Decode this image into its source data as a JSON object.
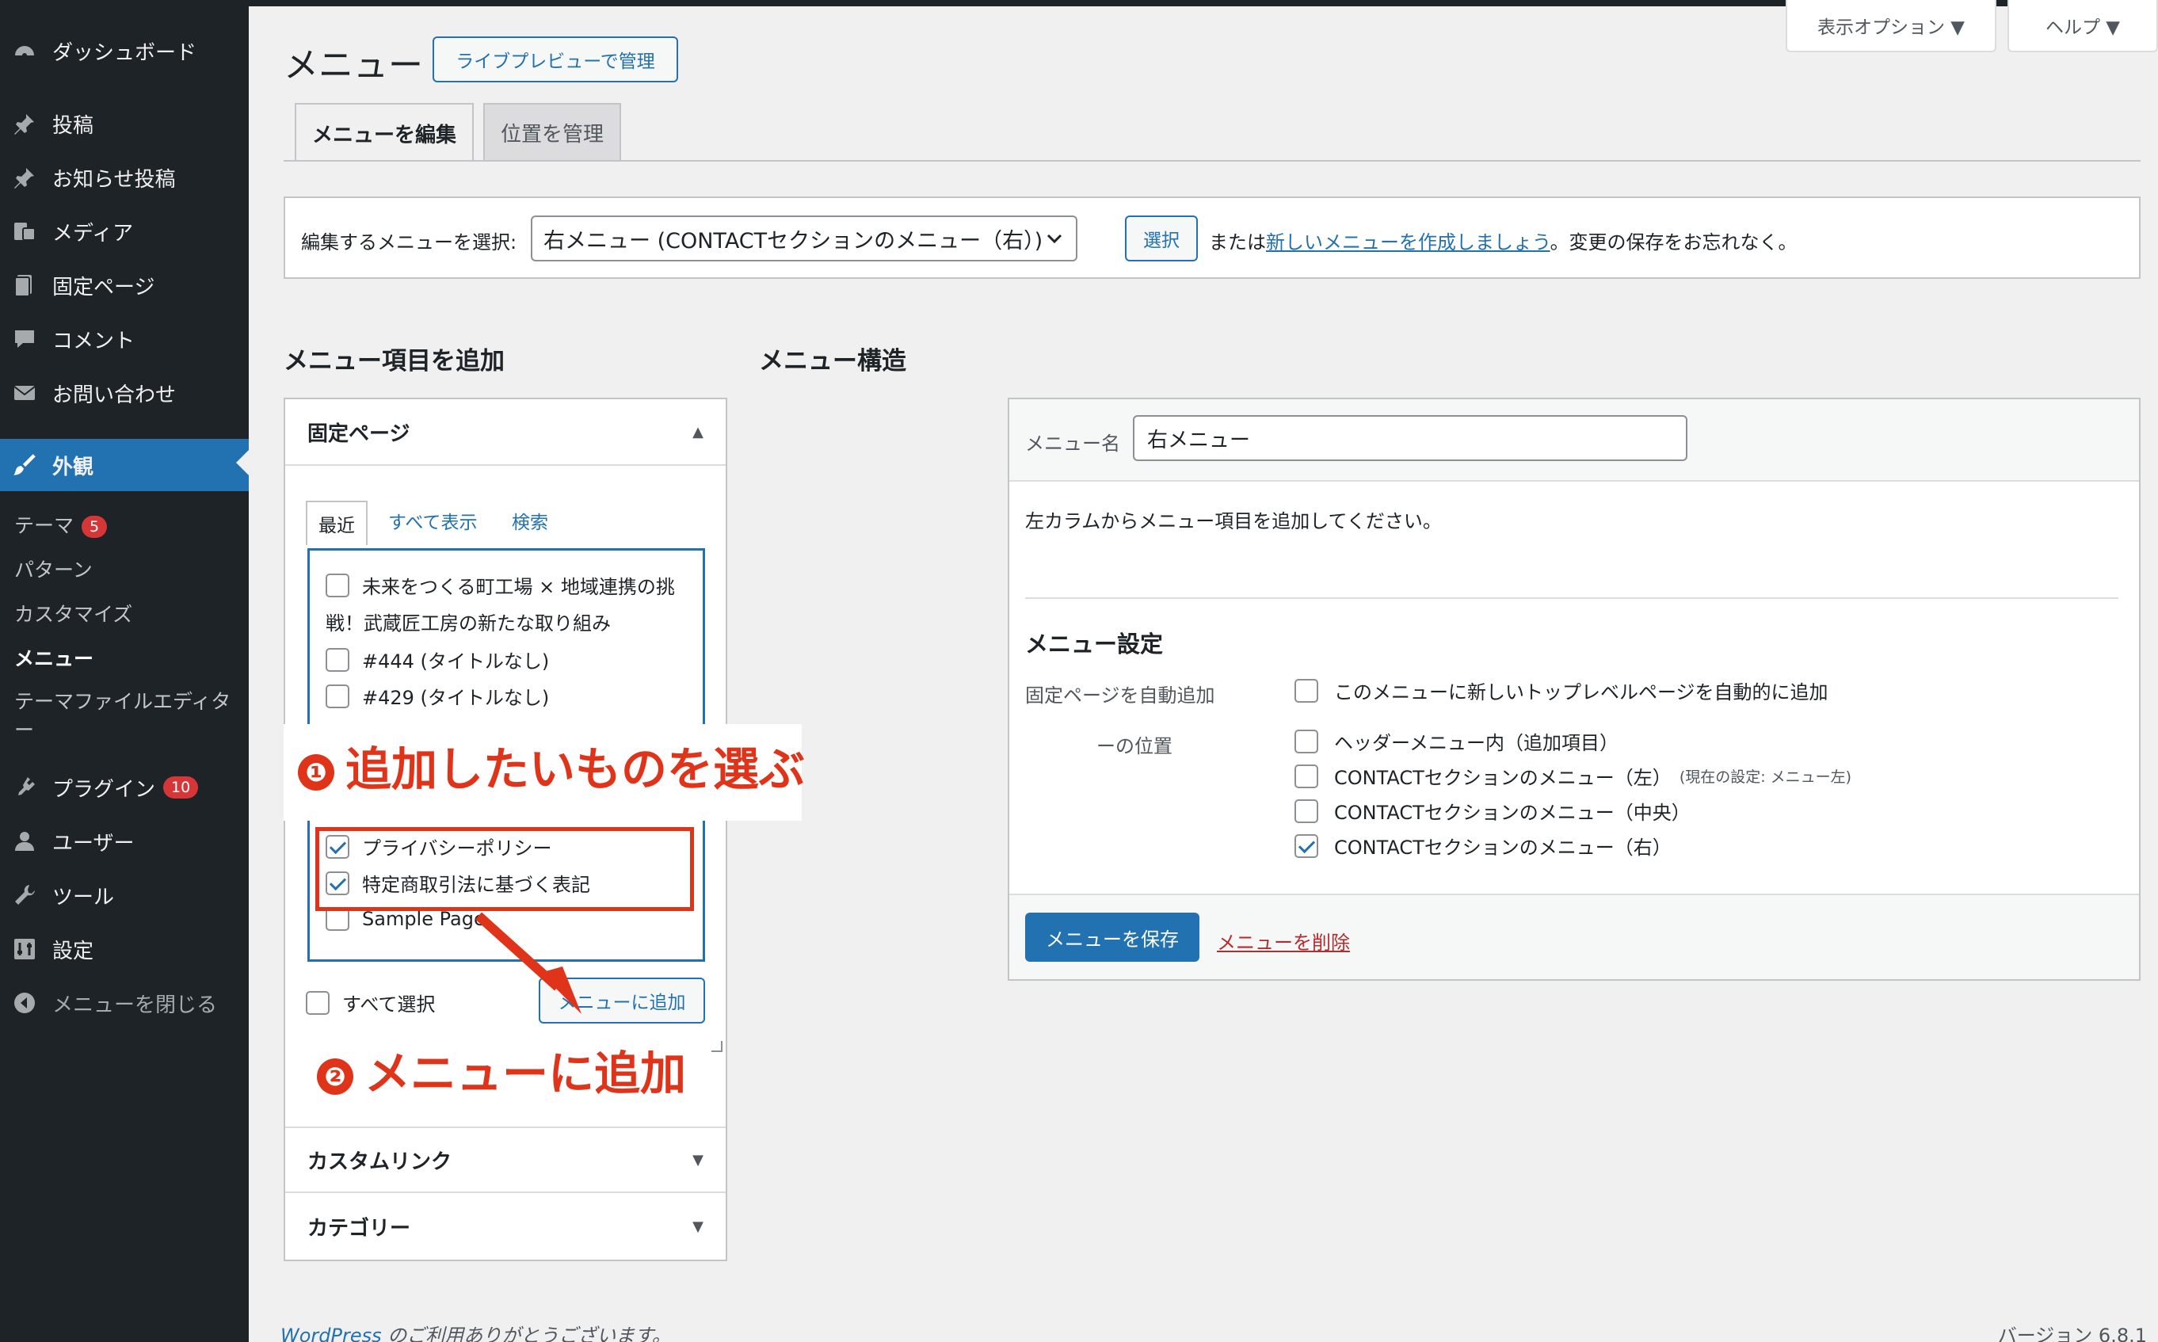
{
  "sidebar": {
    "dashboard": "ダッシュボード",
    "posts": "投稿",
    "news": "お知らせ投稿",
    "media": "メディア",
    "pages": "固定ページ",
    "comments": "コメント",
    "contact": "お問い合わせ",
    "appearance": "外観",
    "sub": {
      "themes": "テーマ",
      "themes_badge": "5",
      "patterns": "パターン",
      "customize": "カスタマイズ",
      "menus": "メニュー",
      "theme_editor_1": "テーマファイルエディタ",
      "theme_editor_2": "ー"
    },
    "plugins": "プラグイン",
    "plugins_badge": "10",
    "users": "ユーザー",
    "tools": "ツール",
    "settings": "設定",
    "collapse": "メニューを閉じる"
  },
  "header": {
    "title": "メニュー",
    "live_preview": "ライブプレビューで管理",
    "screen_options": "表示オプション ▼",
    "help": "ヘルプ ▼"
  },
  "tabs": {
    "edit": "メニューを編集",
    "locations": "位置を管理"
  },
  "select_bar": {
    "label": "編集するメニューを選択:",
    "selected": "右メニュー (CONTACTセクションのメニュー（右）)",
    "select_button": "選択",
    "or_text": "または",
    "create_link": "新しいメニューを作成しましょう",
    "tail": "。変更の保存をお忘れなく。"
  },
  "add_items": {
    "heading": "メニュー項目を追加",
    "pages_section": "固定ページ",
    "tab_recent": "最近",
    "tab_all": "すべて表示",
    "tab_search": "検索",
    "items": [
      {
        "label": "未来をつくる町工場 × 地域連携の挑",
        "checked": false
      },
      {
        "label": "戦！武蔵匠工房の新たな取り組み",
        "checked": null
      },
      {
        "label": "#444 (タイトルなし)",
        "checked": false
      },
      {
        "label": "#429 (タイトルなし)",
        "checked": false
      },
      {
        "label": "プライバシーポリシー",
        "checked": true
      },
      {
        "label": "特定商取引法に基づく表記",
        "checked": true
      },
      {
        "label": "Sample Page",
        "checked": false
      }
    ],
    "select_all": "すべて選択",
    "add_button": "メニューに追加",
    "custom_link": "カスタムリンク",
    "categories": "カテゴリー"
  },
  "annotations": {
    "step1_num": "❶",
    "step1": "追加したいものを選ぶ",
    "step2_num": "❷",
    "step2": "メニューに追加"
  },
  "structure": {
    "heading": "メニュー構造",
    "name_label": "メニュー名",
    "name_value": "右メニュー",
    "instruction": "左カラムからメニュー項目を追加してください。",
    "settings_heading": "メニュー設定",
    "auto_add_label": "固定ページを自動追加",
    "auto_add_option": "このメニューに新しいトップレベルページを自動的に追加",
    "position_label": "ーの位置",
    "positions": [
      {
        "label": "ヘッダーメニュー内（追加項目）",
        "note": "",
        "checked": false
      },
      {
        "label": "CONTACTセクションのメニュー（左）",
        "note": "(現在の設定: メニュー左)",
        "checked": false
      },
      {
        "label": "CONTACTセクションのメニュー（中央）",
        "note": "",
        "checked": false
      },
      {
        "label": "CONTACTセクションのメニュー（右）",
        "note": "",
        "checked": true
      }
    ],
    "save_button": "メニューを保存",
    "delete_link": "メニューを削除"
  },
  "footer": {
    "wordpress": "WordPress",
    "thanks": " のご利用ありがとうございます。",
    "version": "バージョン 6.8.1"
  },
  "colors": {
    "sidebar_bg": "#1d2327",
    "accent": "#2271b1",
    "annotation": "#e0341a",
    "badge": "#d63638"
  }
}
